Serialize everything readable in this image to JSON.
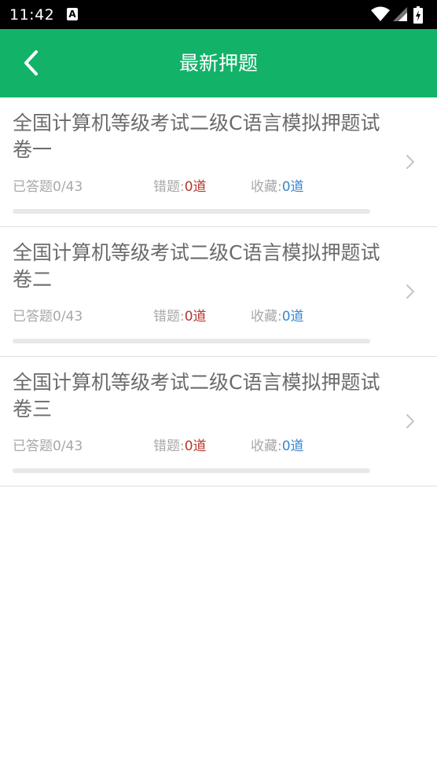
{
  "status_bar": {
    "time": "11:42",
    "notification_icon_letter": "A",
    "icons": [
      "wifi-icon",
      "cell-signal-icon",
      "battery-icon"
    ]
  },
  "app_bar": {
    "title": "最新押题",
    "back_icon": "chevron-left-icon",
    "background_color": "#12b269"
  },
  "papers": [
    {
      "title": "全国计算机等级考试二级C语言模拟押题试卷一",
      "answered_label": "已答题0/43",
      "wrong_label": "错题:",
      "wrong_value": "0道",
      "fav_label": "收藏:",
      "fav_value": "0道",
      "progress": 0
    },
    {
      "title": "全国计算机等级考试二级C语言模拟押题试卷二",
      "answered_label": "已答题0/43",
      "wrong_label": "错题:",
      "wrong_value": "0道",
      "fav_label": "收藏:",
      "fav_value": "0道",
      "progress": 0
    },
    {
      "title": "全国计算机等级考试二级C语言模拟押题试卷三",
      "answered_label": "已答题0/43",
      "wrong_label": "错题:",
      "wrong_value": "0道",
      "fav_label": "收藏:",
      "fav_value": "0道",
      "progress": 0
    }
  ],
  "colors": {
    "wrong_value": "#b5382f",
    "fav_value": "#3a86cf",
    "title_text": "#6b6b6b",
    "meta_text": "#a8a8a8"
  }
}
